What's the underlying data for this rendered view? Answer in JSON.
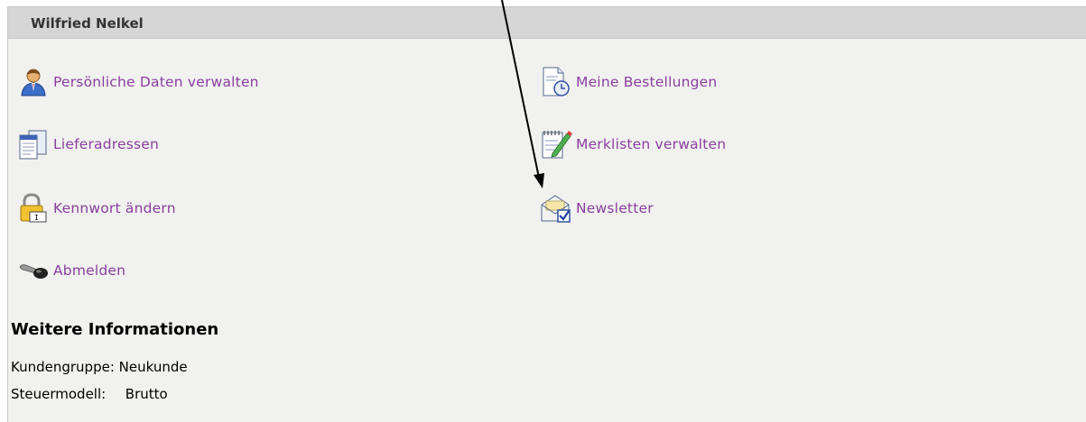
{
  "panel": {
    "title": "Wilfried Nelkel"
  },
  "links": {
    "personal_data": {
      "label": "Persönliche Daten verwalten",
      "icon": "user-icon"
    },
    "orders": {
      "label": "Meine Bestellungen",
      "icon": "document-clock-icon"
    },
    "delivery_addresses": {
      "label": "Lieferadressen",
      "icon": "documents-icon"
    },
    "wishlists": {
      "label": "Merklisten verwalten",
      "icon": "notepad-pencil-icon"
    },
    "password": {
      "label": "Kennwort ändern",
      "icon": "lock-icon"
    },
    "newsletter": {
      "label": "Newsletter",
      "icon": "envelope-check-icon"
    },
    "logout": {
      "label": "Abmelden",
      "icon": "key-icon"
    }
  },
  "info": {
    "title": "Weitere Informationen",
    "customer_group_label": "Kundengruppe:",
    "customer_group_value": "Neukunde",
    "tax_model_label": "Steuermodell:",
    "tax_model_value": "Brutto"
  },
  "colors": {
    "link": "#8a3f9e",
    "panel_bg": "#f1f1ef",
    "header_bg": "#d6d6d6"
  }
}
